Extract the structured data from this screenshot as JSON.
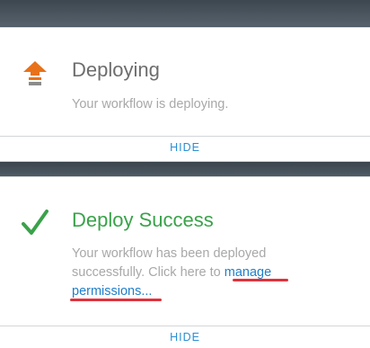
{
  "deploying_card": {
    "title": "Deploying",
    "message": "Your workflow is deploying.",
    "icon": "upload-arrow-icon",
    "accent": "#e8711a",
    "hide_label": "HIDE"
  },
  "success_card": {
    "title": "Deploy Success",
    "message_prefix": "Your workflow has been deployed successfully. Click here to",
    "link_text": "manage permissions...",
    "icon": "checkmark-icon",
    "accent": "#3aa24a",
    "hide_label": "HIDE"
  }
}
